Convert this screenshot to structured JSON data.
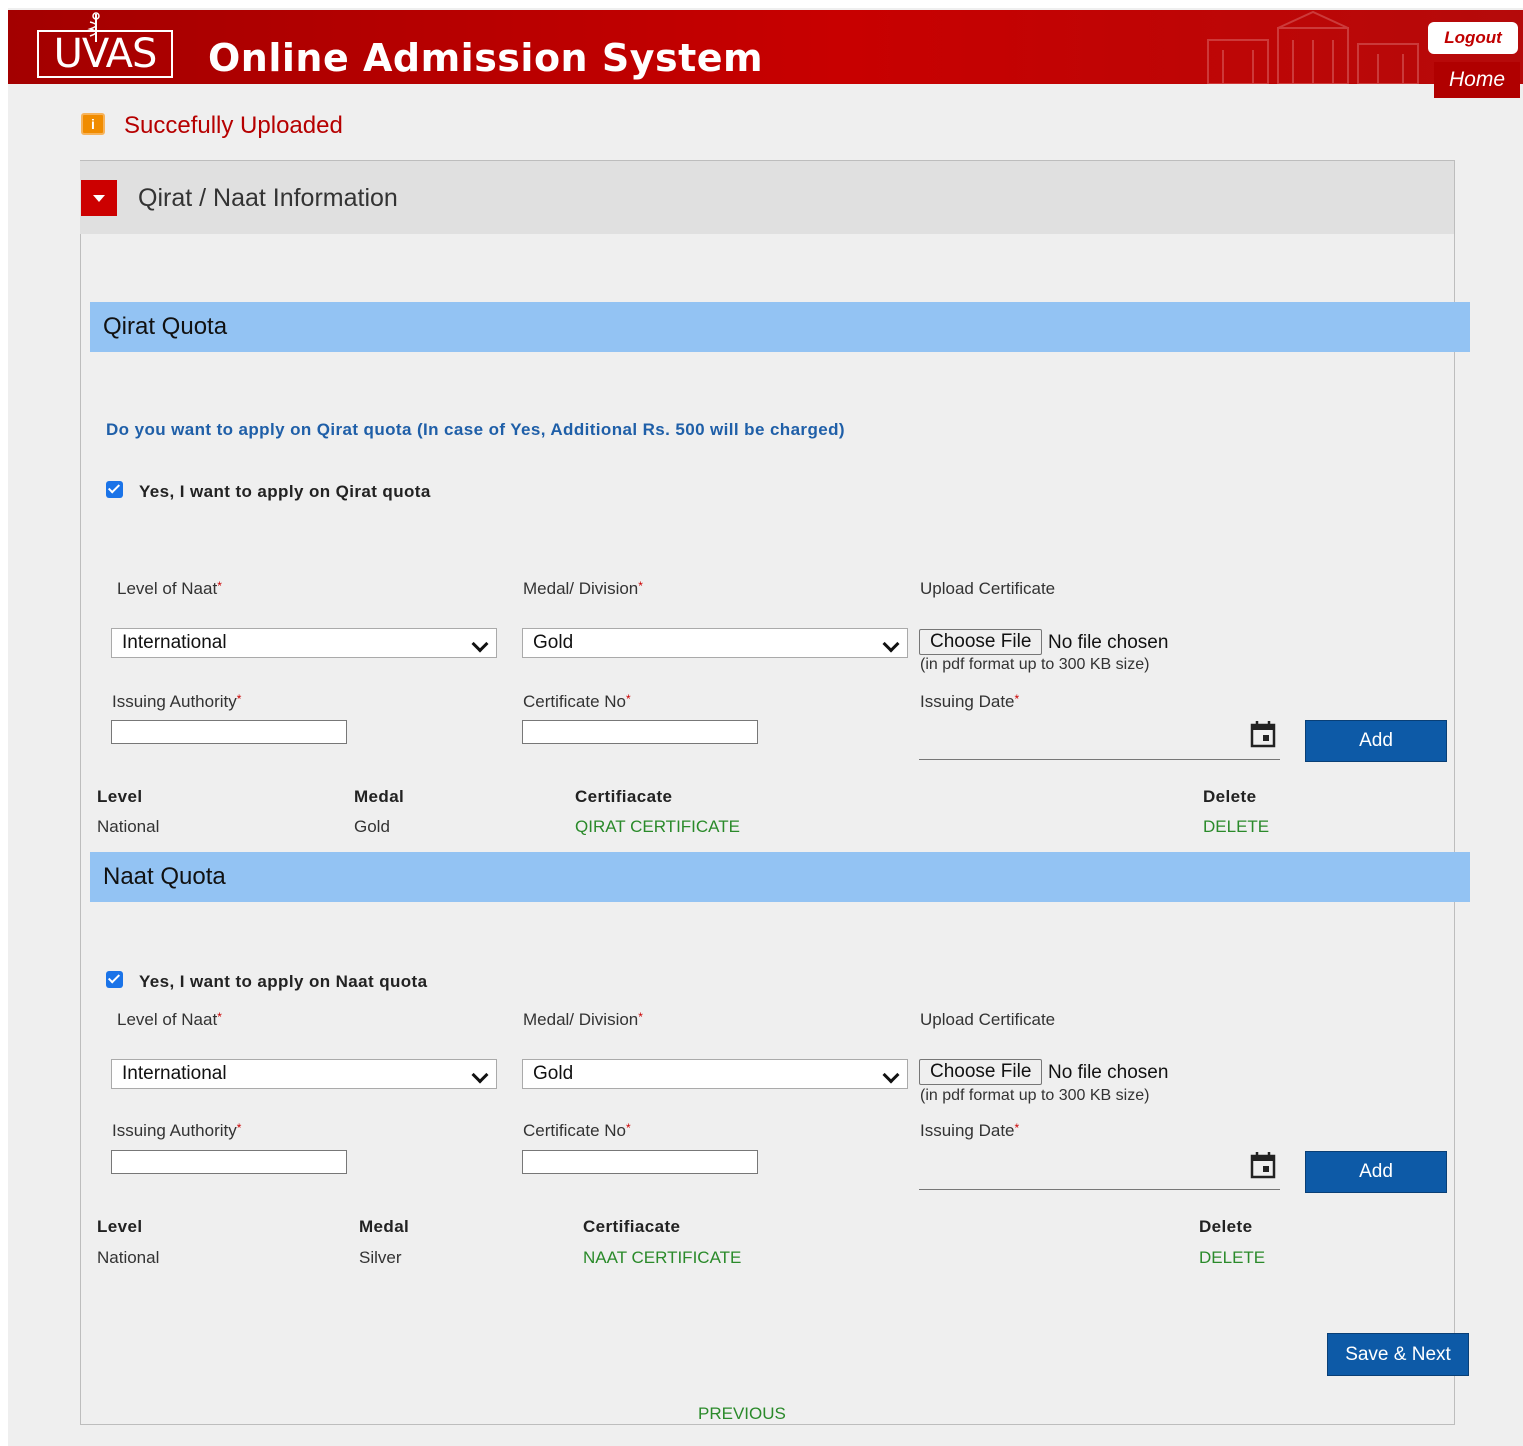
{
  "header": {
    "logo_text": "UVAS",
    "title": "Online Admission System",
    "logout_label": "Logout",
    "home_label": "Home",
    "colors": {
      "brand_red": "#c80000",
      "white": "#ffffff"
    }
  },
  "notice": {
    "icon": "info-icon",
    "text": "Succefully Uploaded",
    "color": "#b60000"
  },
  "panel": {
    "title": "Qirat / Naat Information",
    "toggle_icon": "caret-down-icon"
  },
  "qirat": {
    "section_title": "Qirat Quota",
    "question": "Do you want to apply on Qirat quota  (In case of Yes, Additional Rs. 500 will be charged)",
    "checkbox_label": "Yes, I want to apply on Qirat quota",
    "checked": true,
    "form": {
      "level_label": "Level of Naat",
      "medal_label": "Medal/ Division",
      "upload_label": "Upload Certificate",
      "level_value": "International",
      "medal_value": "Gold",
      "choose_file_label": "Choose File",
      "no_file_text": "No file chosen",
      "file_hint": "(in pdf format up to 300 KB size)",
      "authority_label": "Issuing Authority",
      "certno_label": "Certificate No",
      "date_label": "Issuing Date",
      "authority_value": "",
      "certno_value": "",
      "date_value": "",
      "add_label": "Add"
    },
    "table": {
      "headers": {
        "level": "Level",
        "medal": "Medal",
        "certificate": "Certifiacate",
        "delete": "Delete"
      },
      "rows": [
        {
          "level": "National",
          "medal": "Gold",
          "certificate": "QIRAT CERTIFICATE",
          "delete": "DELETE"
        }
      ]
    }
  },
  "naat": {
    "section_title": "Naat Quota",
    "checkbox_label": "Yes, I want to apply on Naat quota",
    "checked": true,
    "form": {
      "level_label": "Level of Naat",
      "medal_label": "Medal/ Division",
      "upload_label": "Upload Certificate",
      "level_value": "International",
      "medal_value": "Gold",
      "choose_file_label": "Choose File",
      "no_file_text": "No file chosen",
      "file_hint": "(in pdf format up to 300 KB size)",
      "authority_label": "Issuing Authority",
      "certno_label": "Certificate No",
      "date_label": "Issuing Date",
      "authority_value": "",
      "certno_value": "",
      "date_value": "",
      "add_label": "Add"
    },
    "table": {
      "headers": {
        "level": "Level",
        "medal": "Medal",
        "certificate": "Certifiacate",
        "delete": "Delete"
      },
      "rows": [
        {
          "level": "National",
          "medal": "Silver",
          "certificate": "NAAT CERTIFICATE",
          "delete": "DELETE"
        }
      ]
    }
  },
  "footer": {
    "save_next_label": "Save & Next",
    "previous_label": "PREVIOUS"
  },
  "colors": {
    "section_blue": "#93c3f3",
    "button_blue": "#0d5aa7",
    "link_green": "#2a8a2a",
    "question_blue": "#1f5fa8"
  }
}
